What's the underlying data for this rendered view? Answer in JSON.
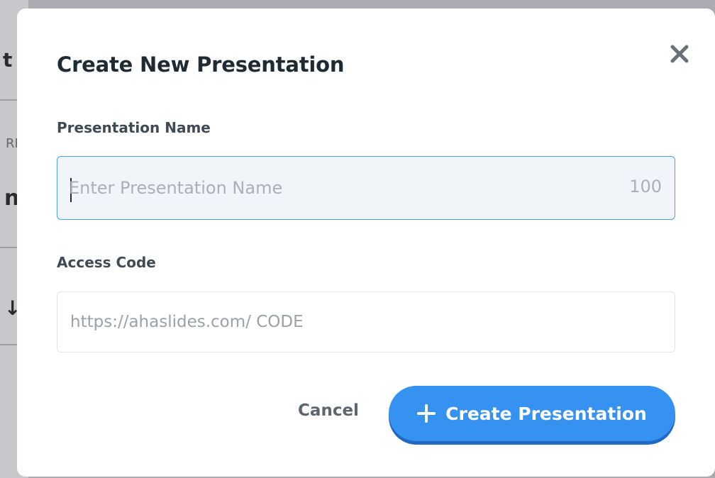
{
  "background": {
    "fragments": [
      "t",
      "RE",
      "n",
      "↓"
    ]
  },
  "dialog": {
    "title": "Create New Presentation",
    "close_icon": "close-icon",
    "name_field": {
      "label": "Presentation Name",
      "value": "",
      "placeholder": "Enter Presentation Name",
      "char_limit": "100"
    },
    "code_field": {
      "label": "Access Code",
      "value": "",
      "placeholder": "https://ahaslides.com/ CODE"
    },
    "buttons": {
      "cancel": "Cancel",
      "create": "Create Presentation",
      "create_icon": "plus-icon"
    }
  },
  "colors": {
    "primary": "#3592f0",
    "primary_shadow": "#1f68c4",
    "focus_border": "#4aa2e3",
    "title": "#1f2a33"
  }
}
